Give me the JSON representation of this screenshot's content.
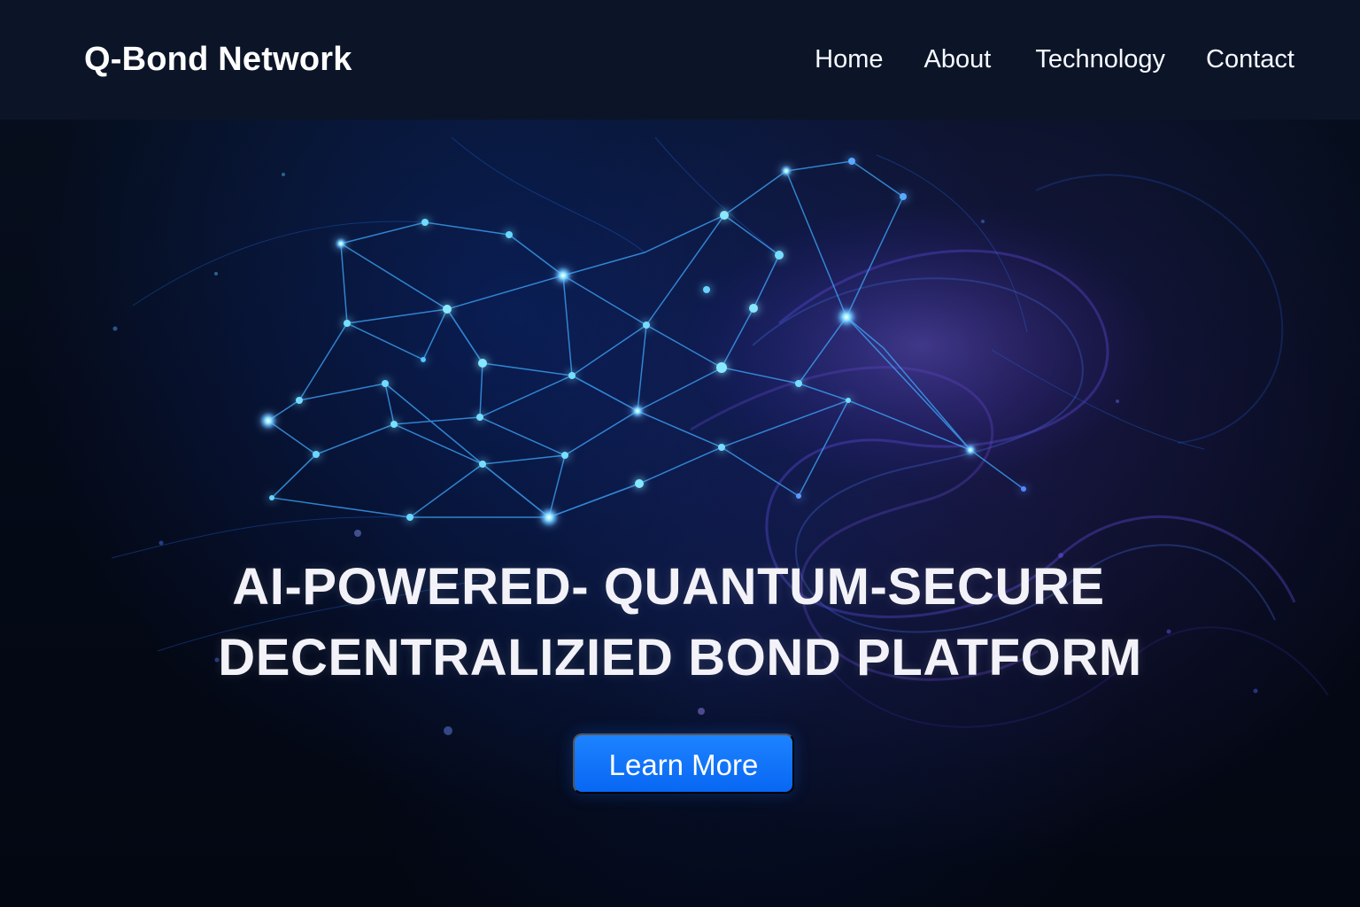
{
  "nav": {
    "brand": "Q-Bond Network",
    "links": [
      {
        "label": "Home"
      },
      {
        "label": "About"
      },
      {
        "label": "Technology"
      },
      {
        "label": "Contact"
      }
    ]
  },
  "hero": {
    "headline_line_1": "AI-POWERED- QUANTUM-SECURE",
    "headline_line_2": "DECENTRALIZIED BOND PLATFORM",
    "button_label": "Learn More"
  },
  "colors": {
    "nav_background": "#0c1528",
    "page_background": "#040815",
    "accent_blue": "#0b6fff",
    "network_blue": "#56b8ff",
    "network_purple": "#7f5cff"
  }
}
